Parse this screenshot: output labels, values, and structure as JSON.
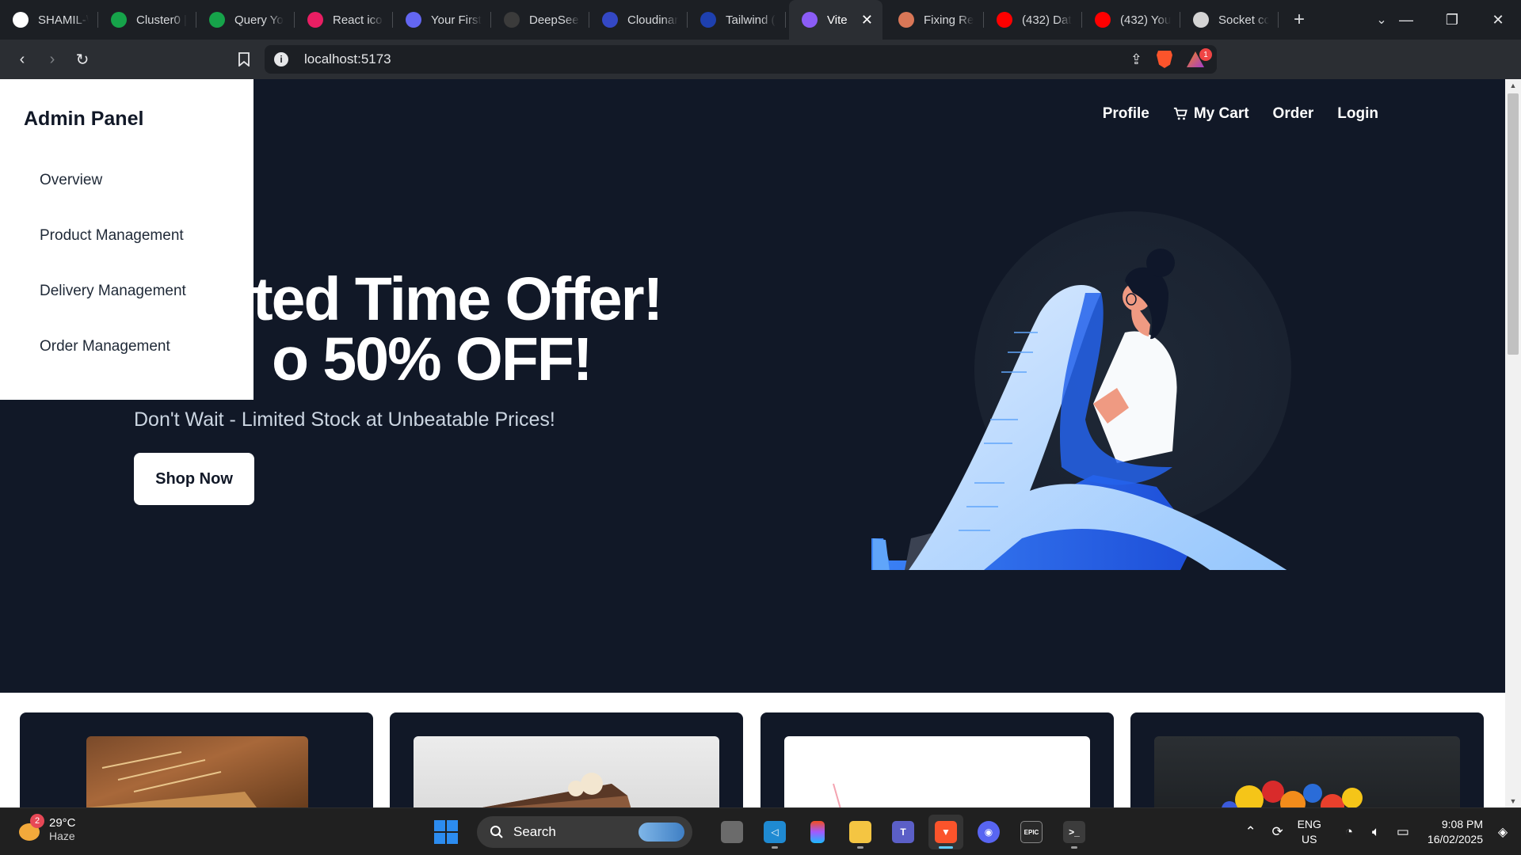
{
  "browser": {
    "tabs": [
      {
        "title": "SHAMIL-\\",
        "icon": "github-icon",
        "color": "#ffffff",
        "active": false
      },
      {
        "title": "Cluster0 |",
        "icon": "mongodb-leaf-icon",
        "color": "#16a34a",
        "active": false
      },
      {
        "title": "Query Yo",
        "icon": "mongodb-leaf-icon",
        "color": "#16a34a",
        "active": false
      },
      {
        "title": "React icor",
        "icon": "react-icons-icon",
        "color": "#e91e63",
        "active": false
      },
      {
        "title": "Your First",
        "icon": "render-icon",
        "color": "#6366f1",
        "active": false
      },
      {
        "title": "DeepSeel",
        "icon": "deepseek-icon",
        "color": "#3b3b3b",
        "active": false
      },
      {
        "title": "Cloudinar",
        "icon": "cloudinary-icon",
        "color": "#3448c5",
        "active": false
      },
      {
        "title": "Tailwind (",
        "icon": "tailwind-icon",
        "color": "#1e40af",
        "active": false
      },
      {
        "title": "Vite",
        "icon": "vite-icon",
        "color": "#8b5cf6",
        "active": true
      },
      {
        "title": "Fixing Re",
        "icon": "claude-icon",
        "color": "#d97757",
        "active": false
      },
      {
        "title": "(432) Dat",
        "icon": "youtube-icon",
        "color": "#ff0000",
        "active": false
      },
      {
        "title": "(432) You",
        "icon": "youtube-icon",
        "color": "#ff0000",
        "active": false
      },
      {
        "title": "Socket cc",
        "icon": "socketio-icon",
        "color": "#d4d4d4",
        "active": false
      }
    ],
    "url": "localhost:5173",
    "notification_count": "1"
  },
  "admin_panel": {
    "title": "Admin Panel",
    "items": [
      "Overview",
      "Product Management",
      "Delivery Management",
      "Order Management"
    ]
  },
  "navbar": {
    "profile": "Profile",
    "cart": "My Cart",
    "order": "Order",
    "login": "Login"
  },
  "hero": {
    "title_line1": "ted Time Offer!",
    "title_line2": "o 50% OFF!",
    "subtitle": "Don't Wait - Limited Stock at Unbeatable Prices!",
    "cta": "Shop Now"
  },
  "colors": {
    "page_bg": "#111827",
    "sidebar_bg": "#ffffff",
    "accent_blue": "#2563eb"
  },
  "taskbar": {
    "weather_temp": "29°C",
    "weather_desc": "Haze",
    "weather_alerts": "2",
    "search_placeholder": "Search",
    "lang_line1": "ENG",
    "lang_line2": "US",
    "time": "9:08 PM",
    "date": "16/02/2025"
  }
}
